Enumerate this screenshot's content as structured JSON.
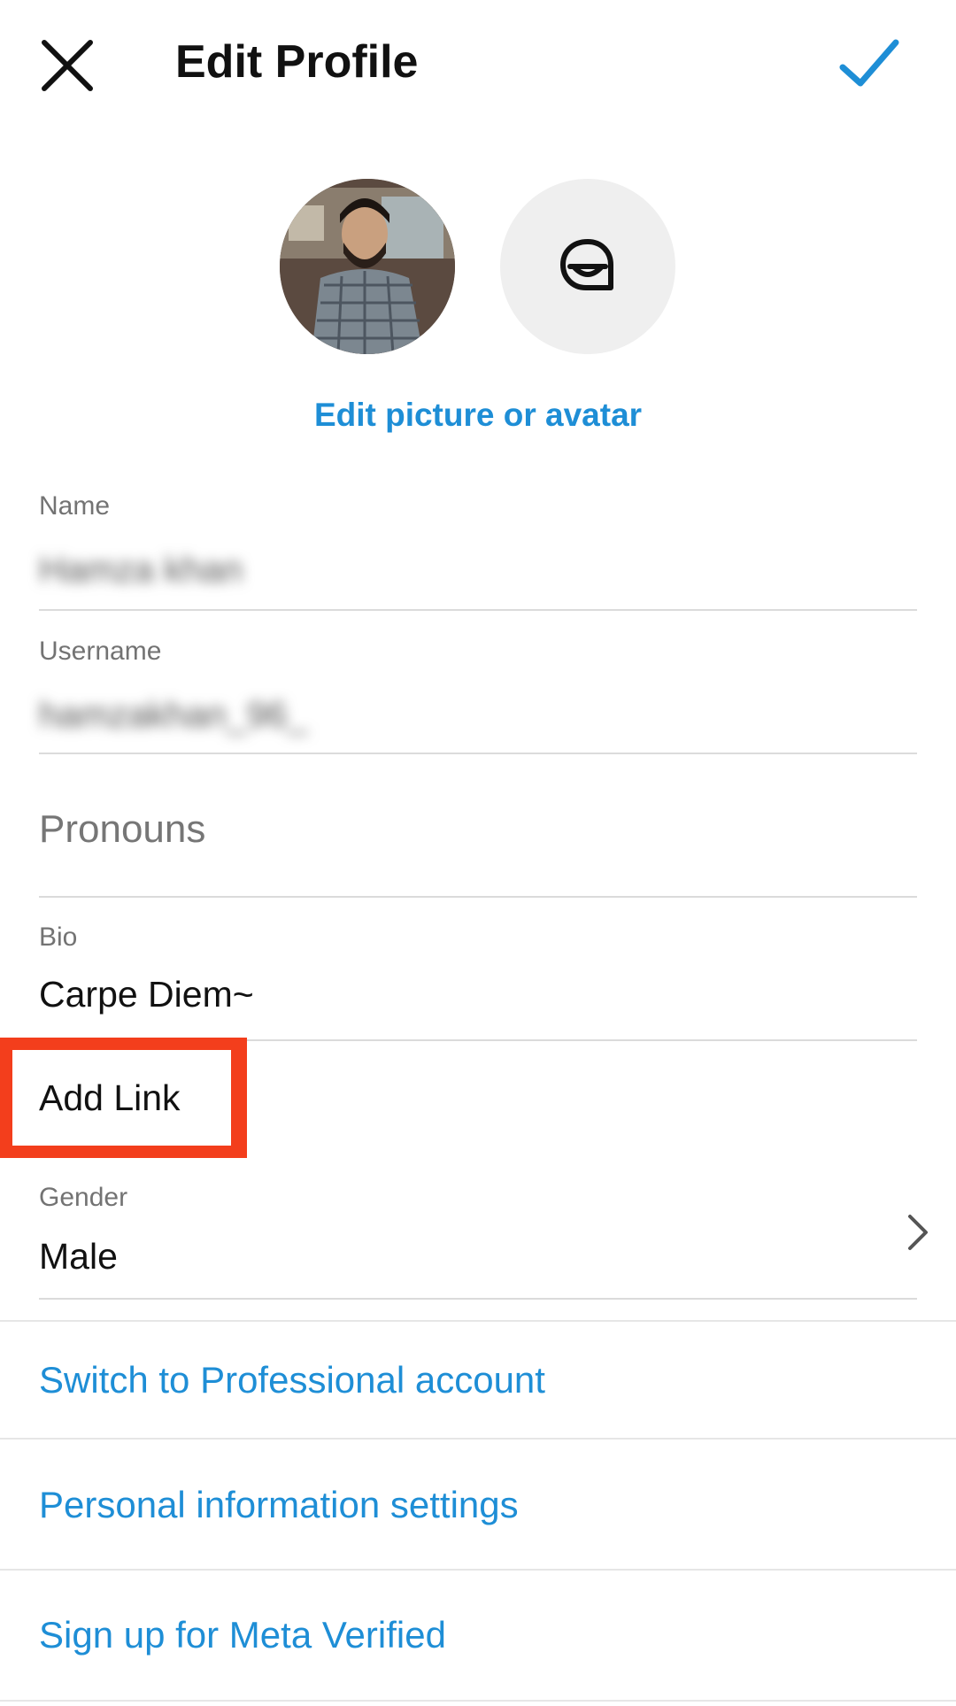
{
  "header": {
    "title": "Edit Profile",
    "close_icon": "close-icon",
    "check_icon": "checkmark-icon",
    "accent": "#1e8ed6"
  },
  "profile": {
    "photo_icon": "profile-photo",
    "avatar_icon": "avatar-sticker-icon",
    "edit_label": "Edit picture or avatar"
  },
  "fields": {
    "name": {
      "label": "Name",
      "value": "Hamza khan"
    },
    "username": {
      "label": "Username",
      "value": "hamzakhan_96_"
    },
    "pronouns": {
      "placeholder": "Pronouns"
    },
    "bio": {
      "label": "Bio",
      "value": "Carpe Diem~"
    },
    "add_link": {
      "label": "Add Link"
    },
    "gender": {
      "label": "Gender",
      "value": "Male",
      "chevron_icon": "chevron-right-icon"
    }
  },
  "links": {
    "professional": "Switch to Professional account",
    "personal_info": "Personal information settings",
    "meta_verified": "Sign up for Meta Verified"
  },
  "highlight": {
    "color": "#f33e1c"
  }
}
